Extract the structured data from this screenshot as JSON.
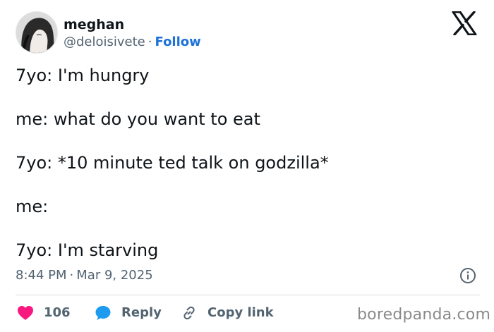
{
  "author": {
    "name": "meghan",
    "handle": "@deloisivete",
    "separator": "·",
    "follow_label": "Follow"
  },
  "tweet": {
    "lines": [
      "7yo: I'm hungry",
      "me: what do you want to eat",
      "7yo: *10 minute ted talk on godzilla*",
      "me:",
      "7yo: I'm starving"
    ],
    "time": "8:44 PM",
    "date_separator": "·",
    "date": "Mar 9, 2025"
  },
  "actions": {
    "like_count": "106",
    "reply_label": "Reply",
    "copy_label": "Copy link"
  },
  "watermark": "boredpanda.com",
  "icons": {
    "brand": "x-logo-icon",
    "info": "info-icon",
    "like": "heart-icon",
    "reply": "speech-bubble-icon",
    "copy": "link-icon"
  },
  "colors": {
    "text": "#0f1419",
    "secondary": "#536471",
    "follow": "#1d72d8",
    "like": "#f91880",
    "reply": "#1d9bf0"
  }
}
